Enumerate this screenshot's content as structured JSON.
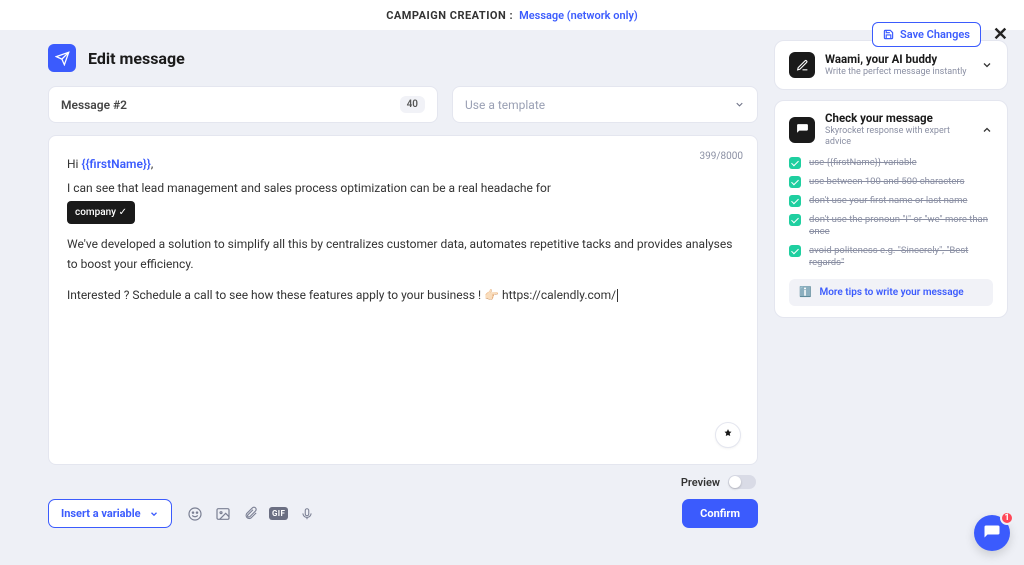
{
  "topbar": {
    "label": "CAMPAIGN CREATION :",
    "value": "Message (network only)"
  },
  "actions": {
    "save": "Save Changes"
  },
  "page_title": "Edit message",
  "message_name": {
    "value": "Message #2",
    "counter": "40"
  },
  "template_select": {
    "placeholder": "Use a template"
  },
  "editor": {
    "counter": "399/8000",
    "hi_prefix": "Hi ",
    "var_firstname": "{{firstName}}",
    "comma": ",",
    "line2": "I can see that lead management and sales process optimization can be a real headache for",
    "chip_company": "company ✓",
    "line3": "We've developed a solution to simplify all this by centralizes customer data, automates repetitive tacks and provides analyses to boost your efficiency.",
    "line4_prefix": "Interested ? Schedule a call to see how these features apply to your business ! 👉🏻 ",
    "line4_url": "https://calendly.com/"
  },
  "preview_label": "Preview",
  "insert_variable": "Insert a variable",
  "confirm": "Confirm",
  "panels": {
    "waami": {
      "title": "Waami, your AI buddy",
      "sub": "Write the perfect message instantly"
    },
    "check": {
      "title": "Check your message",
      "sub": "Skyrocket response with expert advice",
      "tips": [
        "use {{firstName}} variable",
        "use between 100 and 500 characters",
        "don't use your first name or last name",
        "don't use the pronoun \"I\" or \"we\" more than once",
        "avoid politeness e.g. \"Sincerely\", \"Best regards\""
      ],
      "more": "More tips to write your message"
    }
  },
  "chat_badge": "1"
}
